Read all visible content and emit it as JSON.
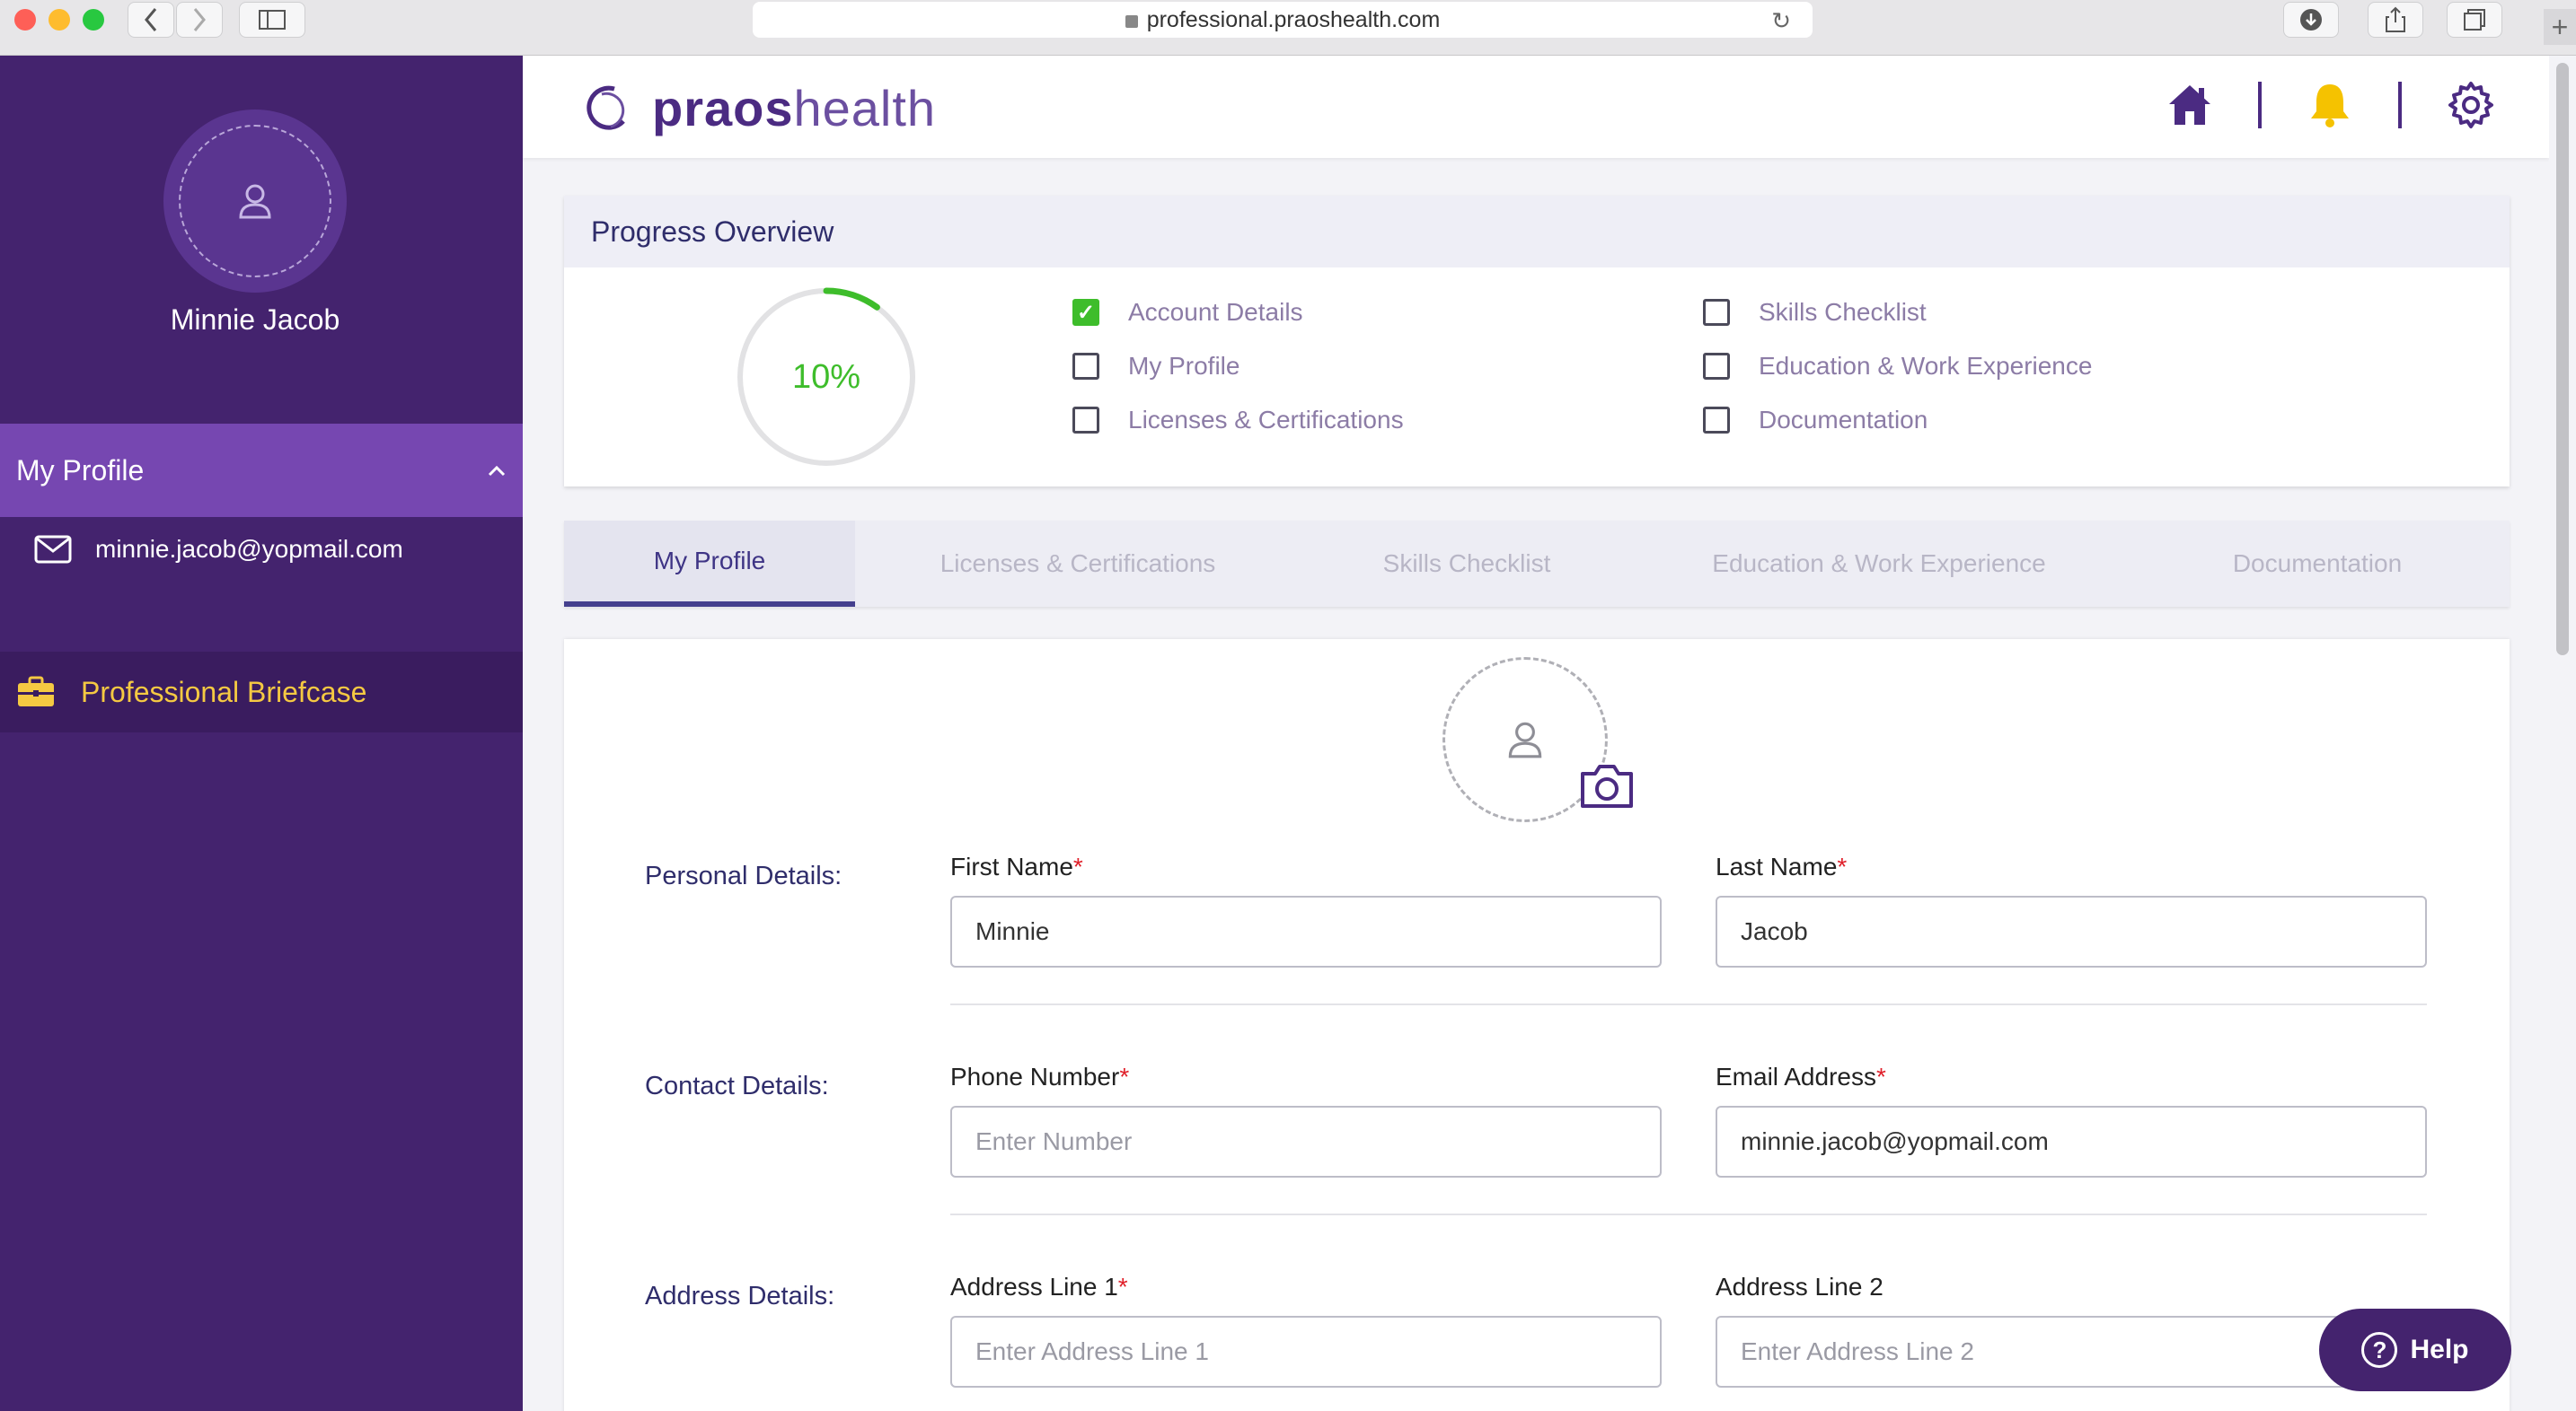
{
  "browser": {
    "url": "professional.praoshealth.com"
  },
  "sidebar": {
    "user_name": "Minnie Jacob",
    "section_title": "My Profile",
    "email": "minnie.jacob@yopmail.com",
    "briefcase_label": "Professional Briefcase"
  },
  "header": {
    "logo_bold": "praos",
    "logo_light": "health"
  },
  "progress": {
    "title": "Progress Overview",
    "percent_label": "10%",
    "percent_value": 0.1,
    "items_left": [
      {
        "label": "Account Details",
        "checked": true
      },
      {
        "label": "My Profile",
        "checked": false
      },
      {
        "label": "Licenses & Certifications",
        "checked": false
      }
    ],
    "items_right": [
      {
        "label": "Skills Checklist",
        "checked": false
      },
      {
        "label": "Education & Work Experience",
        "checked": false
      },
      {
        "label": "Documentation",
        "checked": false
      }
    ]
  },
  "tabs": [
    {
      "label": "My Profile",
      "active": true
    },
    {
      "label": "Licenses & Certifications",
      "active": false
    },
    {
      "label": "Skills Checklist",
      "active": false
    },
    {
      "label": "Education & Work Experience",
      "active": false
    },
    {
      "label": "Documentation",
      "active": false
    }
  ],
  "form": {
    "personal": {
      "section": "Personal Details:",
      "first_name_label": "First Name",
      "first_name_value": "Minnie",
      "last_name_label": "Last Name",
      "last_name_value": "Jacob"
    },
    "contact": {
      "section": "Contact Details:",
      "phone_label": "Phone Number",
      "phone_placeholder": "Enter Number",
      "email_label": "Email Address",
      "email_value": "minnie.jacob@yopmail.com"
    },
    "address": {
      "section": "Address Details:",
      "line1_label": "Address Line 1",
      "line1_placeholder": "Enter Address Line 1",
      "line2_label": "Address Line 2",
      "line2_placeholder": "Enter Address Line 2"
    },
    "required_mark": "*"
  },
  "help": {
    "label": "Help",
    "icon_glyph": "?"
  },
  "colors": {
    "sidebar_bg": "#44236e",
    "sidebar_active": "#7647b1",
    "accent_green": "#3ebd2b",
    "bell_yellow": "#f5c200",
    "brand_purple": "#4b2b82"
  }
}
